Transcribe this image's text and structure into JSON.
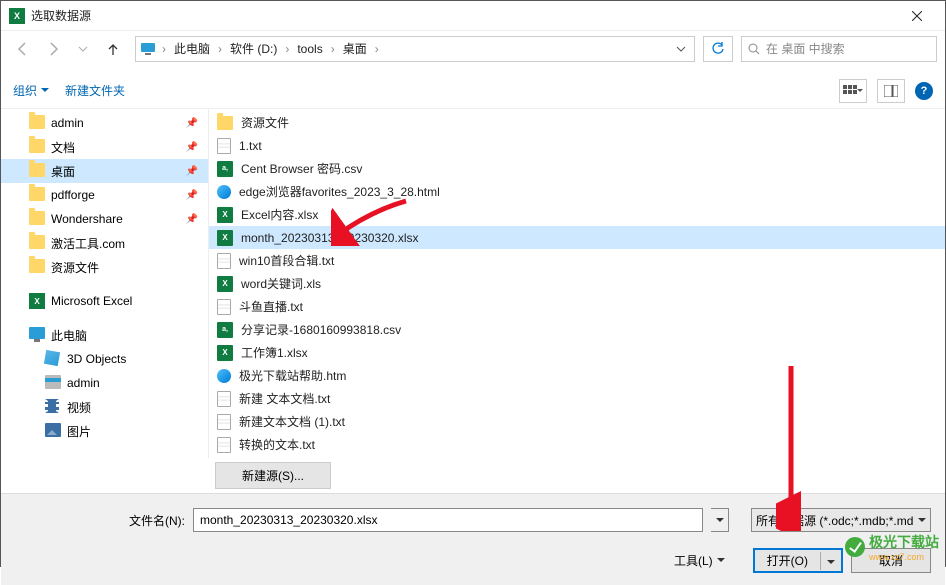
{
  "title": "选取数据源",
  "breadcrumb": {
    "items": [
      "此电脑",
      "软件 (D:)",
      "tools",
      "桌面"
    ]
  },
  "search": {
    "placeholder": "在 桌面 中搜索"
  },
  "toolbar": {
    "organize": "组织",
    "newfolder": "新建文件夹"
  },
  "sidebar": {
    "quick": [
      {
        "label": "admin",
        "icon": "folder",
        "pinned": true
      },
      {
        "label": "文档",
        "icon": "folder",
        "pinned": true
      },
      {
        "label": "桌面",
        "icon": "folder",
        "pinned": true,
        "selected": true
      },
      {
        "label": "pdfforge",
        "icon": "folder",
        "pinned": true
      },
      {
        "label": "Wondershare",
        "icon": "folder",
        "pinned": true
      },
      {
        "label": "激活工具.com",
        "icon": "folder"
      },
      {
        "label": "资源文件",
        "icon": "folder"
      }
    ],
    "excel": {
      "label": "Microsoft Excel"
    },
    "thispc": {
      "label": "此电脑"
    },
    "pcitems": [
      {
        "label": "3D Objects",
        "icon": "cube"
      },
      {
        "label": "admin",
        "icon": "disk"
      },
      {
        "label": "视频",
        "icon": "film"
      },
      {
        "label": "图片",
        "icon": "pic"
      }
    ]
  },
  "files": [
    {
      "name": "资源文件",
      "icon": "folder"
    },
    {
      "name": "1.txt",
      "icon": "txt"
    },
    {
      "name": "Cent Browser 密码.csv",
      "icon": "csv"
    },
    {
      "name": "edge浏览器favorites_2023_3_28.html",
      "icon": "html"
    },
    {
      "name": "Excel内容.xlsx",
      "icon": "xls"
    },
    {
      "name": "month_20230313_20230320.xlsx",
      "icon": "xls",
      "selected": true
    },
    {
      "name": "win10首段合辑.txt",
      "icon": "txt"
    },
    {
      "name": "word关键词.xls",
      "icon": "xls"
    },
    {
      "name": "斗鱼直播.txt",
      "icon": "txt"
    },
    {
      "name": "分享记录-1680160993818.csv",
      "icon": "csv"
    },
    {
      "name": "工作簿1.xlsx",
      "icon": "xls"
    },
    {
      "name": "极光下载站帮助.htm",
      "icon": "html"
    },
    {
      "name": "新建 文本文档.txt",
      "icon": "txt"
    },
    {
      "name": "新建文本文档 (1).txt",
      "icon": "txt"
    },
    {
      "name": "转换的文本.txt",
      "icon": "txt"
    }
  ],
  "newsource": "新建源(S)...",
  "footer": {
    "filename_label": "文件名(N):",
    "filename_value": "month_20230313_20230320.xlsx",
    "filter": "所有数据源 (*.odc;*.mdb;*.md",
    "tools": "工具(L)",
    "open": "打开(O)",
    "cancel": "取消"
  },
  "watermark": {
    "name": "极光下载站",
    "url": "www.xz7.com"
  }
}
